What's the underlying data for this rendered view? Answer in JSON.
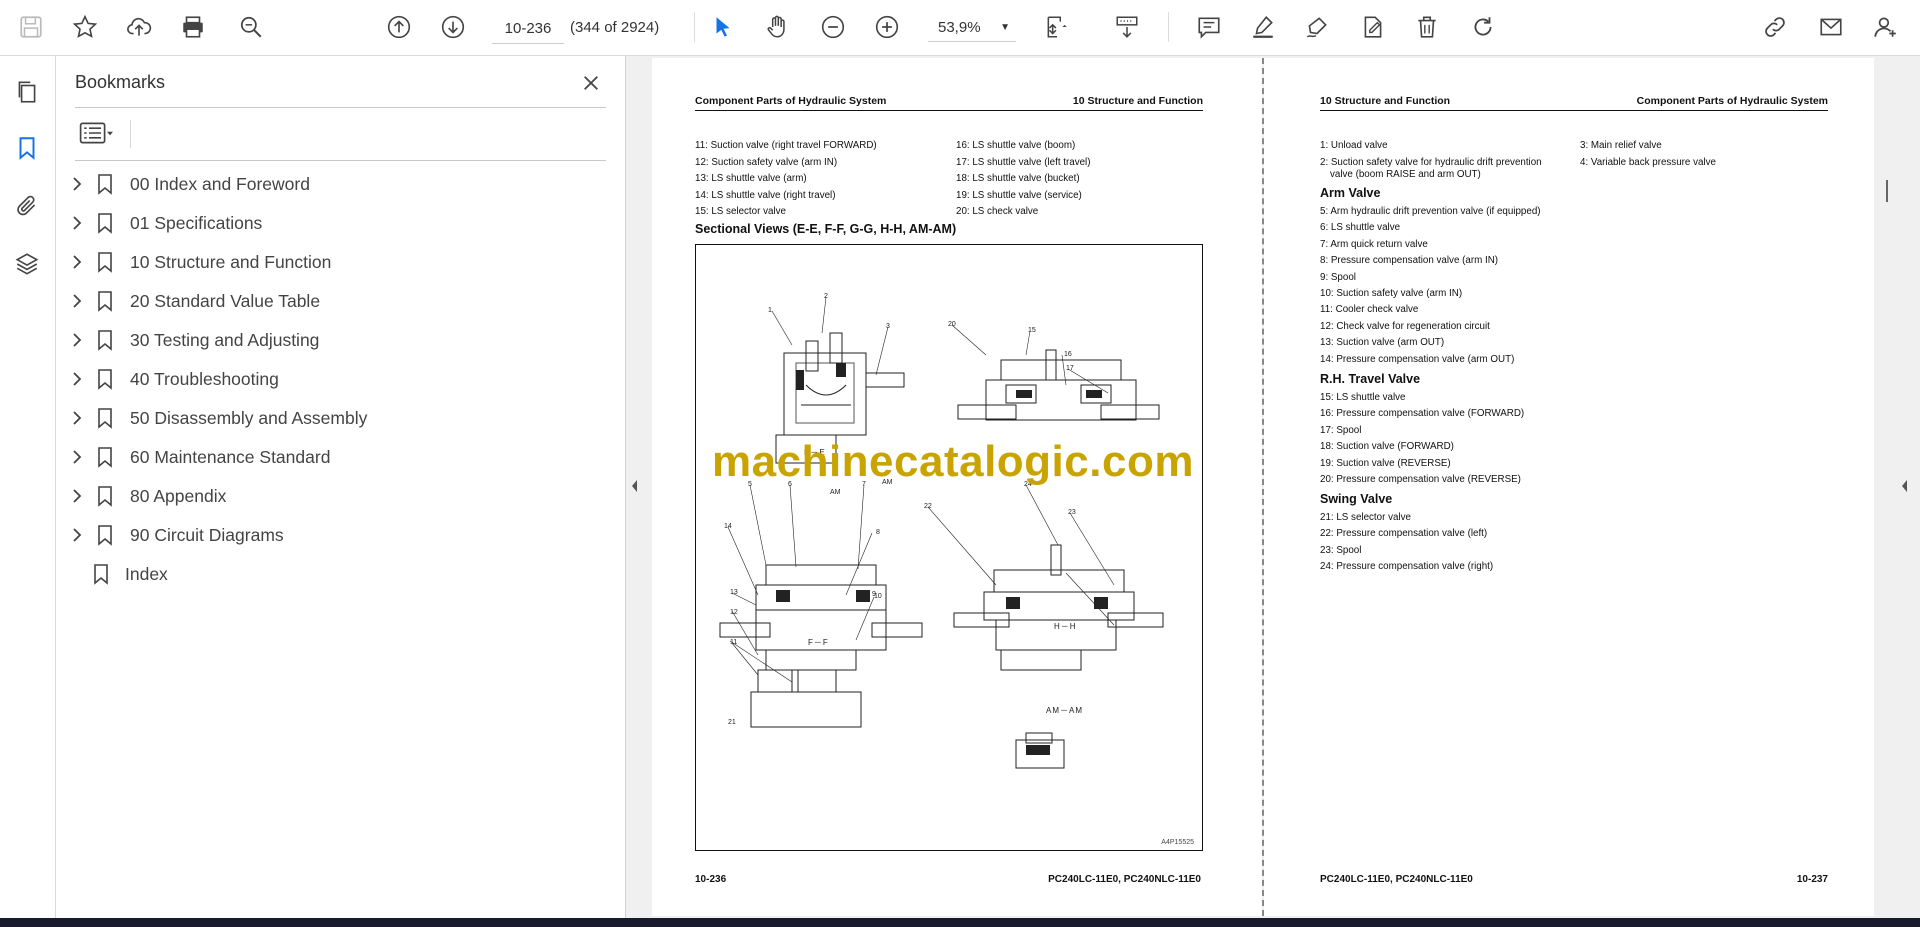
{
  "toolbar": {
    "page_input": "10-236",
    "page_count": "(344 of 2924)",
    "zoom": "53,9%"
  },
  "panel": {
    "title": "Bookmarks"
  },
  "bookmarks": [
    {
      "label": "00 Index and Foreword",
      "expandable": true
    },
    {
      "label": "01 Specifications",
      "expandable": true
    },
    {
      "label": "10 Structure and Function",
      "expandable": true
    },
    {
      "label": "20 Standard Value Table",
      "expandable": true
    },
    {
      "label": "30 Testing and Adjusting",
      "expandable": true
    },
    {
      "label": "40 Troubleshooting",
      "expandable": true
    },
    {
      "label": "50 Disassembly and Assembly",
      "expandable": true
    },
    {
      "label": "60 Maintenance Standard",
      "expandable": true
    },
    {
      "label": "80 Appendix",
      "expandable": true
    },
    {
      "label": "90 Circuit Diagrams",
      "expandable": true
    },
    {
      "label": "Index",
      "expandable": false
    }
  ],
  "left_page": {
    "header_left": "Component Parts of Hydraulic System",
    "header_right": "10 Structure and Function",
    "items_col1": [
      "11: Suction valve (right travel FORWARD)",
      "12: Suction safety valve (arm IN)",
      "13: LS shuttle valve (arm)",
      "14: LS shuttle valve (right travel)",
      "15: LS selector valve"
    ],
    "items_col2": [
      "16: LS shuttle valve (boom)",
      "17: LS shuttle valve (left travel)",
      "18: LS shuttle valve (bucket)",
      "19: LS shuttle valve (service)",
      "20: LS check valve"
    ],
    "section_title": "Sectional Views (E-E, F-F, G-G, H-H, AM-AM)",
    "figure": {
      "caption_ee": "E－E",
      "caption_ff": "F－F",
      "caption_hh": "H－H",
      "caption_amam": "AM－AM",
      "figure_id": "A4P15525",
      "callouts": [
        "1",
        "2",
        "3",
        "20",
        "15",
        "16",
        "17",
        "5",
        "6",
        "AM",
        "7",
        "AM",
        "8",
        "14",
        "9",
        "13",
        "10",
        "12",
        "11",
        "21",
        "24",
        "22",
        "23"
      ]
    },
    "footer_left": "10-236",
    "footer_right": "PC240LC-11E0, PC240NLC-11E0"
  },
  "right_page": {
    "header_left": "10 Structure and Function",
    "header_right": "Component Parts of Hydraulic System",
    "top_col1": [
      "1: Unload valve",
      "2:  Suction  safety  valve  for  hydraulic  drift  prevention",
      "valve (boom RAISE and arm OUT)"
    ],
    "top_col2": [
      "3: Main relief valve",
      "4: Variable back pressure valve"
    ],
    "arm_title": "Arm Valve",
    "arm_items": [
      "5: Arm hydraulic drift prevention valve (if equipped)",
      "6: LS shuttle valve",
      "7: Arm quick return valve",
      "8: Pressure compensation valve (arm IN)",
      "9: Spool",
      "10: Suction safety valve (arm IN)",
      "11: Cooler check valve",
      "12: Check valve for regeneration circuit",
      "13: Suction valve (arm OUT)",
      "14: Pressure compensation valve (arm OUT)"
    ],
    "travel_title": "R.H. Travel Valve",
    "travel_items": [
      "15: LS shuttle valve",
      "16: Pressure compensation valve (FORWARD)",
      "17: Spool",
      "18: Suction valve (FORWARD)",
      "19: Suction valve (REVERSE)",
      "20: Pressure compensation valve (REVERSE)"
    ],
    "swing_title": "Swing Valve",
    "swing_items": [
      "21: LS selector valve",
      "22: Pressure compensation valve (left)",
      "23: Spool",
      "24: Pressure compensation valve (right)"
    ],
    "footer_left": "PC240LC-11E0, PC240NLC-11E0",
    "footer_right": "10-237"
  },
  "watermark": "machinecatalogic.com",
  "colors": {
    "accent": "#1473e6",
    "watermark": "#c9a300"
  }
}
